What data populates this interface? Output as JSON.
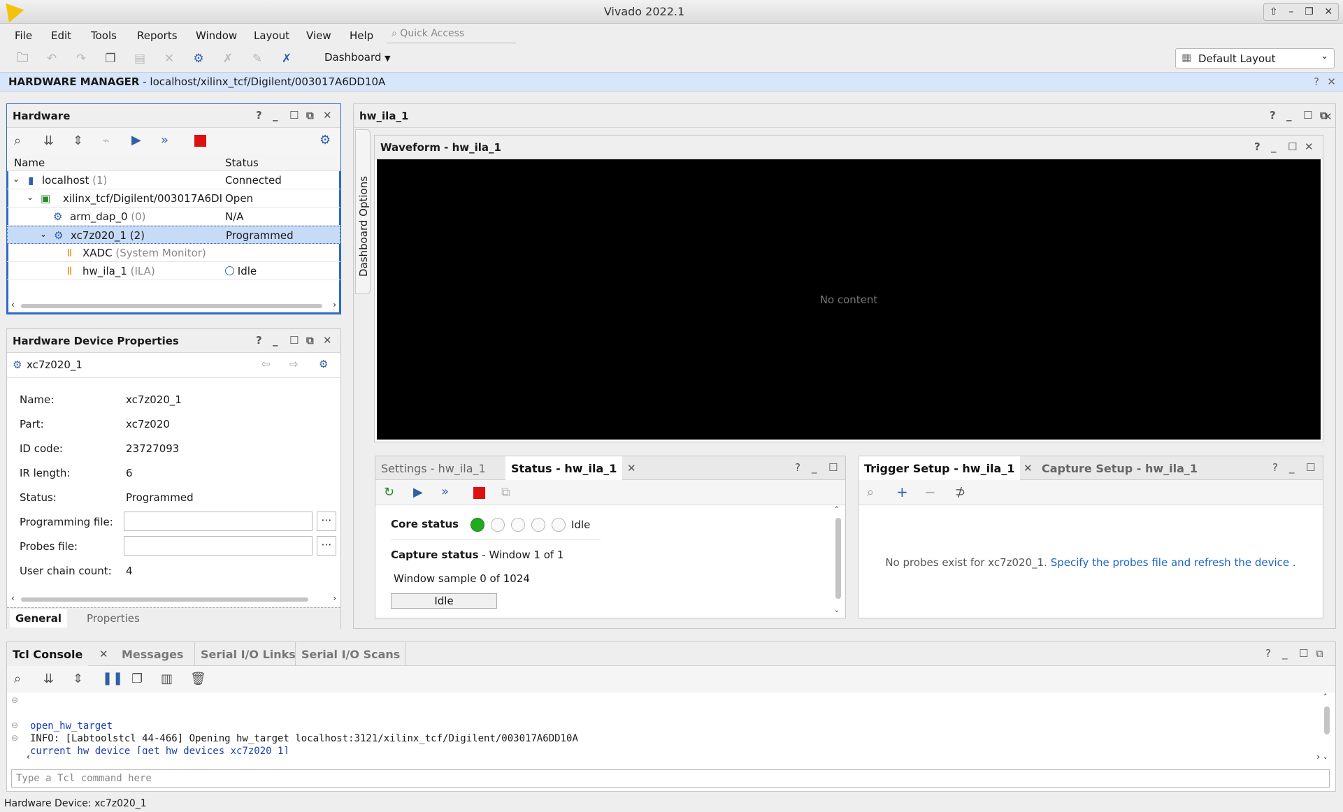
{
  "app": {
    "title": "Vivado 2022.1"
  },
  "menu": [
    "File",
    "Edit",
    "Tools",
    "Reports",
    "Window",
    "Layout",
    "View",
    "Help"
  ],
  "quick_access": {
    "placeholder": "Quick Access"
  },
  "toolbar": {
    "dashboard_label": "Dashboard",
    "layout_value": "Default Layout"
  },
  "banner": {
    "title": "HARDWARE MANAGER",
    "path": " - localhost/xilinx_tcf/Digilent/003017A6DD10A"
  },
  "hardware": {
    "title": "Hardware",
    "columns": [
      "Name",
      "Status"
    ],
    "rows": [
      {
        "name": "localhost",
        "count": "(1)",
        "status": "Connected"
      },
      {
        "name": "xilinx_tcf/Digilent/003017A6DI",
        "count": "",
        "status": "Open"
      },
      {
        "name": "arm_dap_0",
        "count": "(0)",
        "status": "N/A"
      },
      {
        "name": "xc7z020_1",
        "count": "(2)",
        "status": "Programmed"
      },
      {
        "name": "XADC",
        "count": "(System Monitor)",
        "status": ""
      },
      {
        "name": "hw_ila_1",
        "count": "(ILA)",
        "status": "Idle"
      }
    ]
  },
  "device_props": {
    "title": "Hardware Device Properties",
    "device": "xc7z020_1",
    "props": [
      {
        "label": "Name:",
        "value": "xc7z020_1"
      },
      {
        "label": "Part:",
        "value": "xc7z020"
      },
      {
        "label": "ID code:",
        "value": "23727093"
      },
      {
        "label": "IR length:",
        "value": "6"
      },
      {
        "label": "Status:",
        "value": "Programmed"
      },
      {
        "label": "Programming file:",
        "value": ""
      },
      {
        "label": "Probes file:",
        "value": ""
      },
      {
        "label": "User chain count:",
        "value": "4"
      }
    ],
    "tabs": [
      "General",
      "Properties"
    ]
  },
  "ila": {
    "title": "hw_ila_1",
    "dashboard_options": "Dashboard Options",
    "waveform_title": "Waveform - hw_ila_1",
    "waveform_empty": "No content",
    "settings_tabs": [
      "Settings - hw_ila_1",
      "Status - hw_ila_1"
    ],
    "core_status_label": "Core status",
    "core_status_value": "Idle",
    "capture_status_label": "Capture status",
    "capture_status_value": "-  Window 1 of 1",
    "window_sample": "Window sample 0 of 1024",
    "idle_button": "Idle",
    "trigger_tabs": [
      "Trigger Setup - hw_ila_1",
      "Capture Setup - hw_ila_1"
    ],
    "no_probes": "No probes exist for xc7z020_1.",
    "no_probes_link": "Specify the probes file and refresh the device",
    "no_probes_end": "."
  },
  "console": {
    "tabs": [
      "Tcl Console",
      "Messages",
      "Serial I/O Links",
      "Serial I/O Scans"
    ],
    "lines": [
      "open_hw_target",
      "INFO: [Labtoolstcl 44-466] Opening hw_target localhost:3121/xilinx_tcf/Digilent/003017A6DD10A",
      "current_hw_device [get_hw_devices xc7z020_1]"
    ],
    "input_placeholder": "Type a Tcl command here"
  },
  "statusbar": {
    "text": "Hardware Device: xc7z020_1"
  },
  "colors": {
    "accent": "#2f69c4",
    "selection": "#c7dbf7",
    "banner": "#d8e6fb",
    "stop": "#dd1111",
    "link": "#1a64c8",
    "core_green": "#22aa22"
  }
}
